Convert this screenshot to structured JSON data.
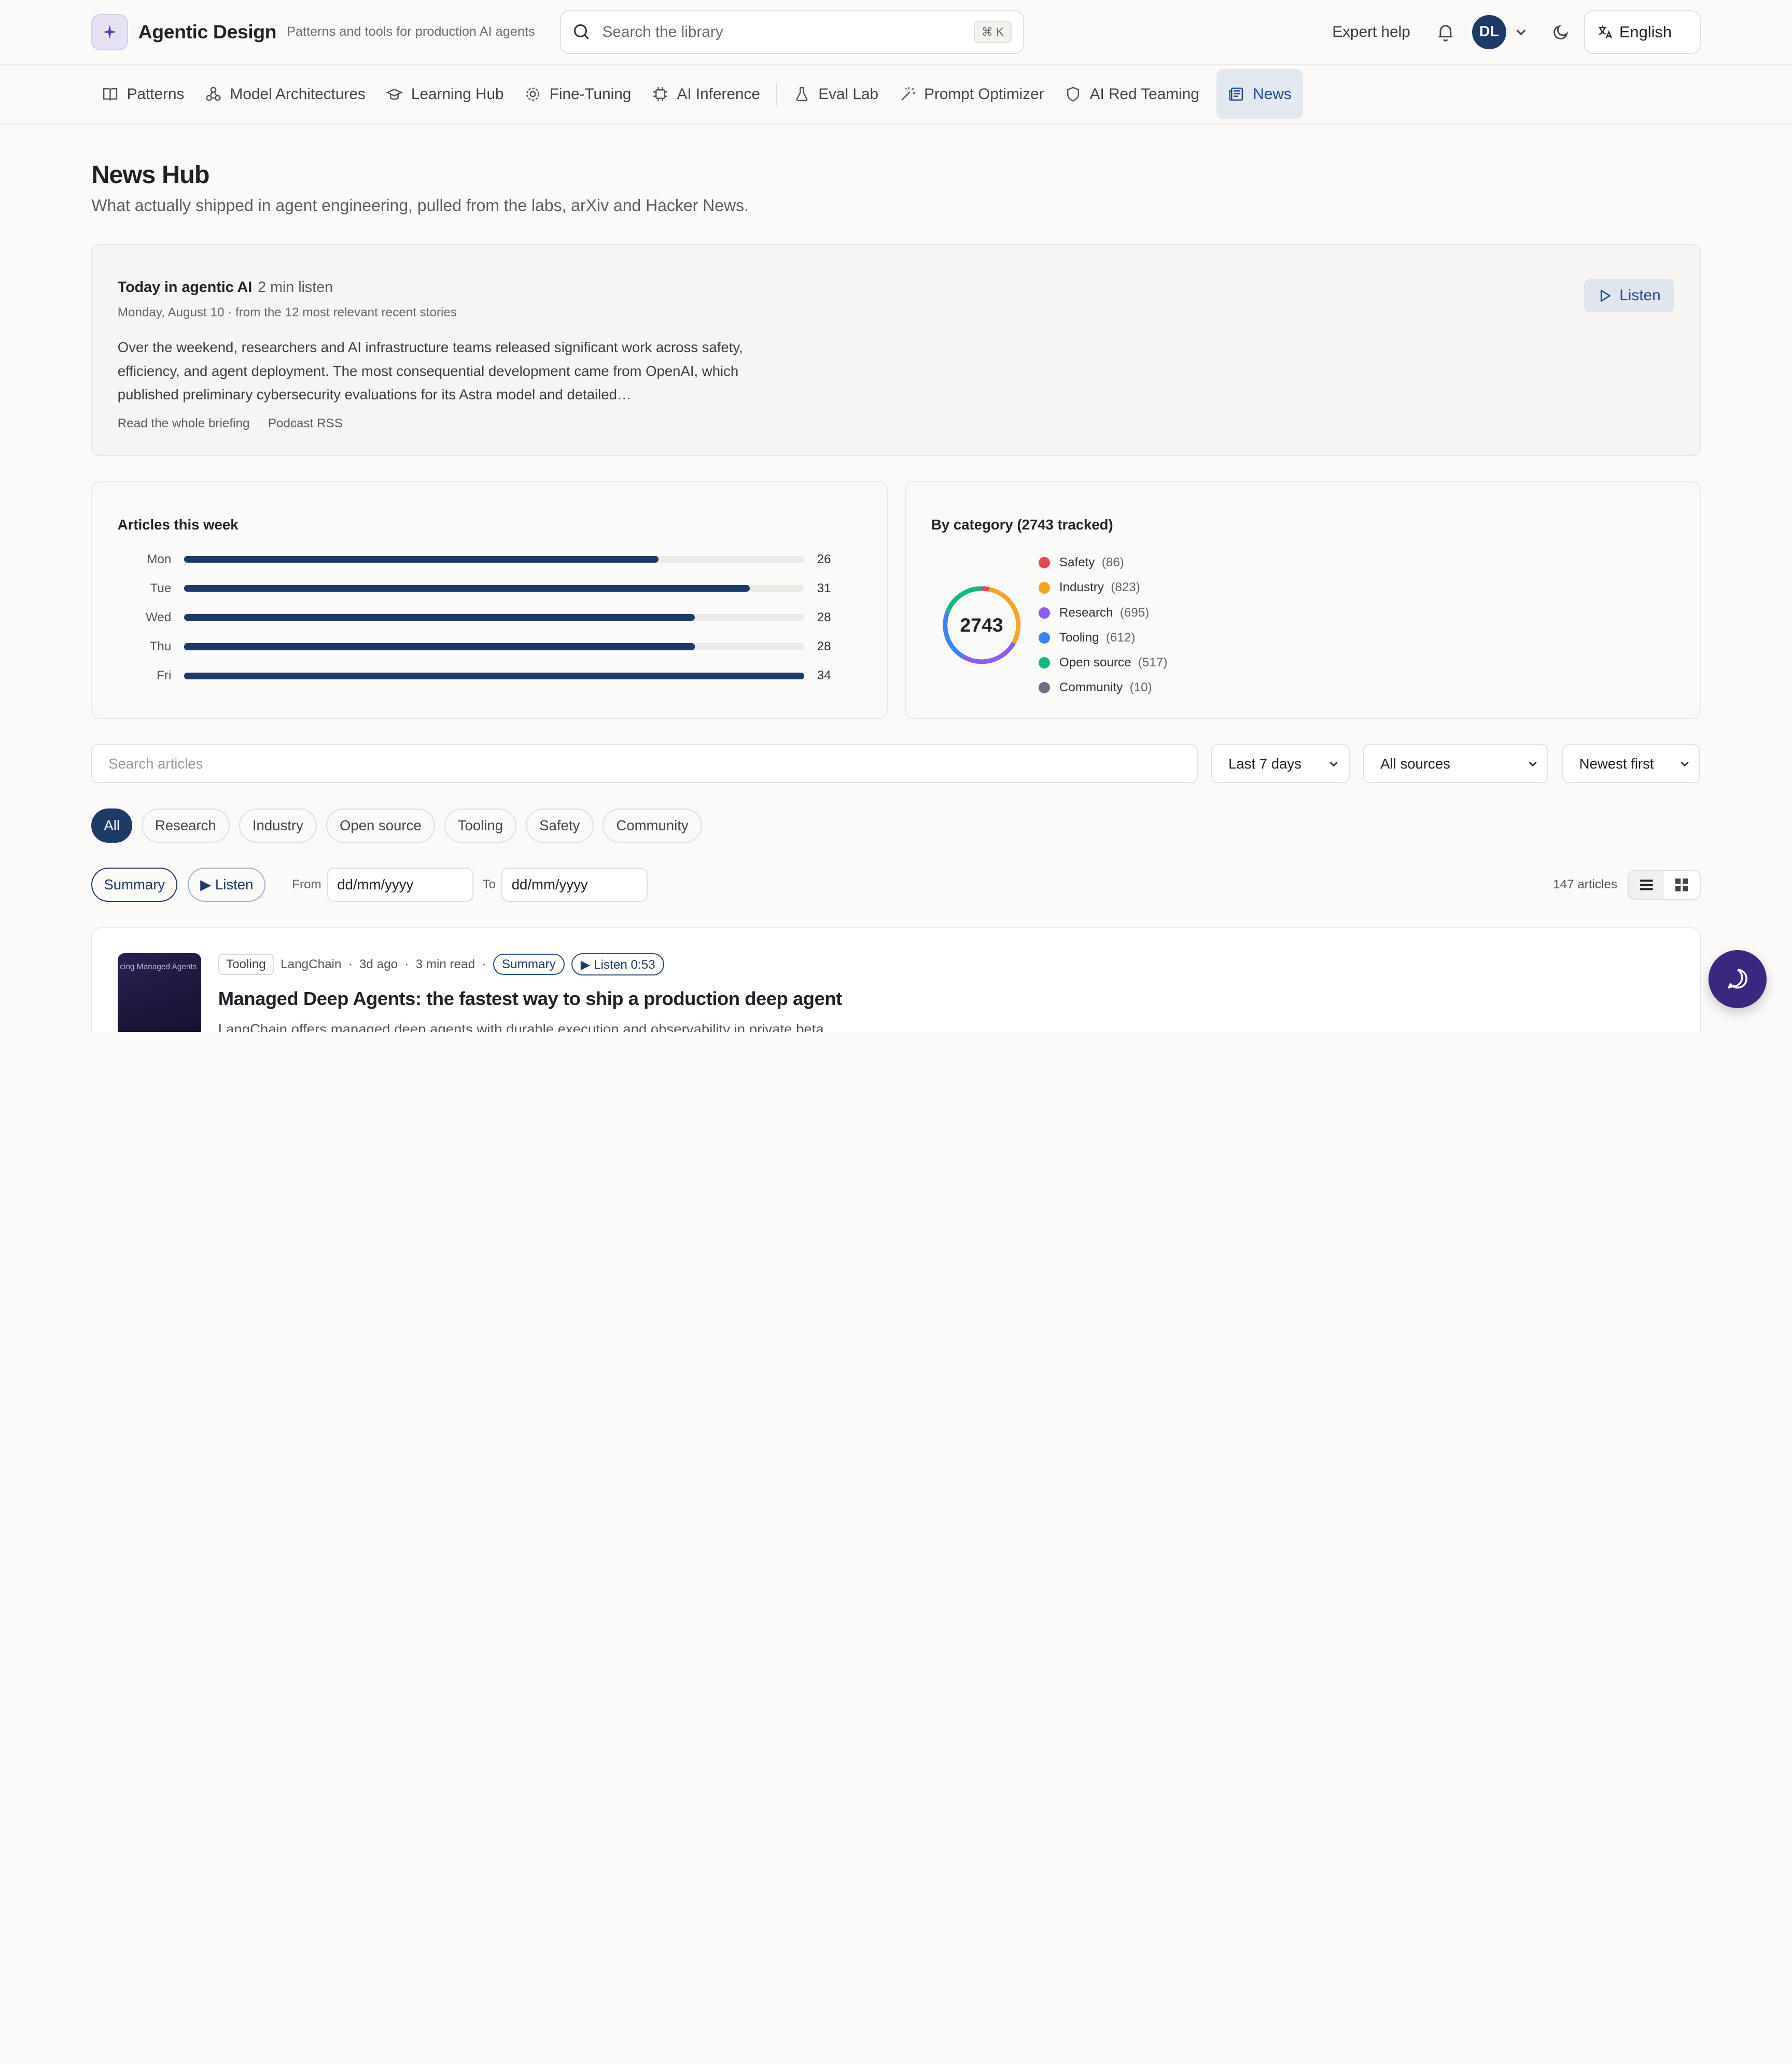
{
  "header": {
    "brand": "Agentic Design",
    "tagline": "Patterns and tools for production AI agents",
    "search_placeholder": "Search the library",
    "shortcut": "⌘ K",
    "expert": "Expert help",
    "avatar": "DL",
    "language": "English",
    "accent": "#1e3a66"
  },
  "nav": [
    {
      "label": "Patterns",
      "icon": "book-icon"
    },
    {
      "label": "Model Architectures",
      "icon": "network-icon"
    },
    {
      "label": "Learning Hub",
      "icon": "graduation-cap-icon"
    },
    {
      "label": "Fine-Tuning",
      "icon": "gear-icon"
    },
    {
      "label": "AI Inference",
      "icon": "chip-icon"
    },
    {
      "label": "Eval Lab",
      "icon": "flask-icon"
    },
    {
      "label": "Prompt Optimizer",
      "icon": "wand-icon"
    },
    {
      "label": "AI Red Teaming",
      "icon": "shield-icon"
    },
    {
      "label": "News",
      "icon": "newspaper-icon",
      "active": true
    }
  ],
  "page": {
    "title": "News Hub",
    "subtitle": "What actually shipped in agent engineering, pulled from the labs, arXiv and Hacker News."
  },
  "briefing": {
    "title": "Today in agentic AI",
    "duration": "2 min listen",
    "meta": "Monday, August 10 · from the 12 most relevant recent stories",
    "body": "Over the weekend, researchers and AI infrastructure teams released significant work across safety, efficiency, and agent deployment. The most consequential development came from OpenAI, which published preliminary cybersecurity evaluations for its Astra model and detailed…",
    "read_link": "Read the whole briefing",
    "rss_link": "Podcast RSS",
    "listen": "Listen"
  },
  "weekly": {
    "title": "Articles this week",
    "max": 34,
    "days": [
      {
        "day": "Mon",
        "count": 26
      },
      {
        "day": "Tue",
        "count": 31
      },
      {
        "day": "Wed",
        "count": 28
      },
      {
        "day": "Thu",
        "count": 28
      },
      {
        "day": "Fri",
        "count": 34
      }
    ]
  },
  "categories": {
    "title": "By category (2743 tracked)",
    "total": "2743",
    "items": [
      {
        "name": "Safety",
        "count": "(86)",
        "value": 86,
        "color": "#e5484d"
      },
      {
        "name": "Industry",
        "count": "(823)",
        "value": 823,
        "color": "#f5a524"
      },
      {
        "name": "Research",
        "count": "(695)",
        "value": 695,
        "color": "#8b5cf6"
      },
      {
        "name": "Tooling",
        "count": "(612)",
        "value": 612,
        "color": "#3b82f6"
      },
      {
        "name": "Open source",
        "count": "(517)",
        "value": 517,
        "color": "#10b981"
      },
      {
        "name": "Community",
        "count": "(10)",
        "value": 10,
        "color": "#6b7280"
      }
    ]
  },
  "filters": {
    "search_placeholder": "Search articles",
    "range": "Last 7 days",
    "sources": "All sources",
    "sort": "Newest first",
    "chips": [
      "All",
      "Research",
      "Industry",
      "Open source",
      "Tooling",
      "Safety",
      "Community"
    ],
    "summary": "Summary",
    "listen": "▶ Listen",
    "from_label": "From",
    "to_label": "To",
    "date_placeholder": "dd/mm/yyyy",
    "count": "147 articles"
  },
  "article": {
    "thumb_text": "cing Managed Agents",
    "tag": "Tooling",
    "source": "LangChain",
    "age": "3d ago",
    "read": "3 min read",
    "summary": "Summary",
    "listen": "▶ Listen 0:53",
    "title": "Managed Deep Agents: the fastest way to ship a production deep agent",
    "desc": "LangChain offers managed deep agents with durable execution and observability in private beta"
  }
}
